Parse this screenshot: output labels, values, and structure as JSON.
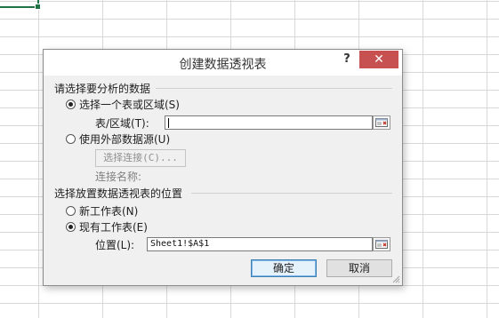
{
  "dialog": {
    "title": "创建数据透视表",
    "help": "?",
    "close": "✕",
    "section_select_data": "请选择要分析的数据",
    "option_table_range": "选择一个表或区域(S)",
    "table_range_label": "表/区域(T):",
    "table_range_value": "",
    "option_external": "使用外部数据源(U)",
    "choose_connection": "选择连接(C)...",
    "connection_name_label": "连接名称:",
    "section_placement": "选择放置数据透视表的位置",
    "option_new_sheet": "新工作表(N)",
    "option_existing_sheet": "现有工作表(E)",
    "location_label": "位置(L):",
    "location_value": "Sheet1!$A$1",
    "ok_label": "确定",
    "cancel_label": "取消"
  },
  "colors": {
    "close_bg": "#c75050",
    "dialog_bg": "#f0f0f0",
    "default_button_border": "#3c7fb1"
  },
  "icons": [
    "help-icon",
    "close-icon",
    "collapse-dialog-icon",
    "resize-grip-icon"
  ]
}
